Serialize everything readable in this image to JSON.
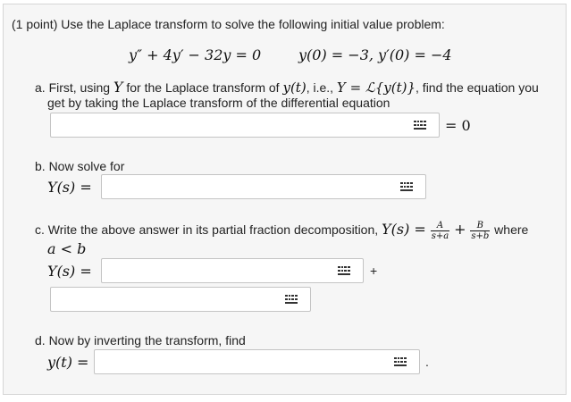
{
  "header": {
    "points": "(1 point)",
    "instruction": "Use the Laplace transform to solve the following initial value problem:"
  },
  "equation": {
    "ode": "y″ + 4y′ − 32y = 0",
    "initial_conditions": "y(0) = −3,  y′(0) = −4"
  },
  "part_a": {
    "text_1": "a. First, using ",
    "Y": "Y",
    "text_2": " for the Laplace transform of ",
    "yt": "y(t)",
    "text_3": ", i.e., ",
    "def": "Y = ℒ{y(t)}",
    "text_4": ", find the equation you",
    "line2": "get by taking the Laplace transform of the differential equation",
    "suffix": "= 0",
    "input_value": ""
  },
  "part_b": {
    "text": "b. Now solve for",
    "label": "Y(s) =",
    "input_value": ""
  },
  "part_c": {
    "text_1": "c. Write the above answer in its partial fraction decomposition, ",
    "Ys": "Y(s) =",
    "A": "A",
    "den_a": "s+a",
    "plus": "+",
    "B": "B",
    "den_b": "s+b",
    "text_2": "where",
    "condition": "a < b",
    "label": "Y(s) =",
    "plus_sign": "+",
    "input_1": "",
    "input_2": ""
  },
  "part_d": {
    "text": "d. Now by inverting the transform, find",
    "label": "y(t) =",
    "period": ".",
    "input_value": ""
  },
  "icons": {
    "keyboard": "keyboard-grid-icon"
  }
}
